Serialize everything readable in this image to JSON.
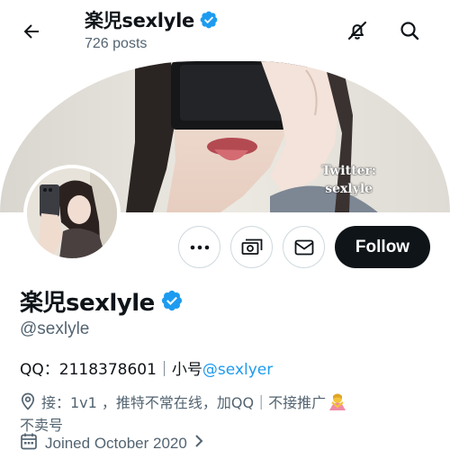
{
  "header": {
    "title": "楽児sexlyle",
    "posts": "726 posts",
    "icons": [
      "back-arrow-icon",
      "verified-badge-icon",
      "no-notifications-icon",
      "search-icon"
    ]
  },
  "banner": {
    "watermark_line1": "Twitter:",
    "watermark_line2": "sexlyle"
  },
  "actions": {
    "more_icon": "more-dots-icon",
    "tip_icon": "tip-money-icon",
    "message_icon": "envelope-icon",
    "follow_label": "Follow"
  },
  "profile": {
    "name": "楽児sexlyle",
    "handle": "@sexlyle",
    "bio_prefix": "QQ：2118378601",
    "bio_sep": "｜",
    "bio_alt_label": "小号",
    "bio_alt_link": "@sexlyer",
    "location": "接：1v1 ，推特不常在线，加QQ｜不接推广",
    "location_cont": "不卖号",
    "joined": "Joined October 2020"
  },
  "colors": {
    "accent": "#1d9bf0",
    "text": "#0f1419",
    "muted": "#536471",
    "follow_bg": "#0f1419",
    "border": "#cfd9de"
  }
}
